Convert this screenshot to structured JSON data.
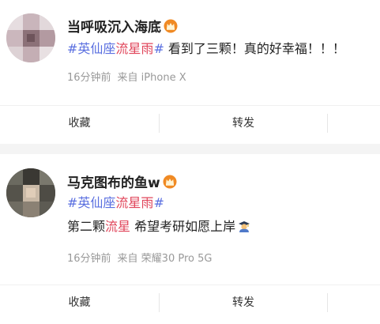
{
  "posts": [
    {
      "username": "当呼吸沉入海底",
      "topic_hash_open": "#",
      "topic_part1": "英仙座",
      "topic_part2": "流星雨",
      "topic_hash_close": "#",
      "text": " 看到了三颗！真的好幸福！！！",
      "time": "16分钟前",
      "source": "来自 iPhone X",
      "favorite_label": "收藏",
      "repost_label": "转发",
      "badge_icon": "crown-badge-icon"
    },
    {
      "username": "马克图布的鱼w",
      "topic_hash_open": "#",
      "topic_part1": "英仙座",
      "topic_part2": "流星雨",
      "topic_hash_close": "#",
      "text_before": "第二颗",
      "text_highlight": "流星",
      "text_after": " 希望考研如愿上岸",
      "emoji_icon": "student-emoji-icon",
      "time": "16分钟前",
      "source": "来自 荣耀30 Pro 5G",
      "favorite_label": "收藏",
      "repost_label": "转发",
      "badge_icon": "crown-badge-icon"
    }
  ],
  "colors": {
    "topic": "#5a6fe0",
    "highlight": "#e0455a",
    "meta": "#999999",
    "separator": "#f4f4f4",
    "badge": "#f08a24"
  }
}
